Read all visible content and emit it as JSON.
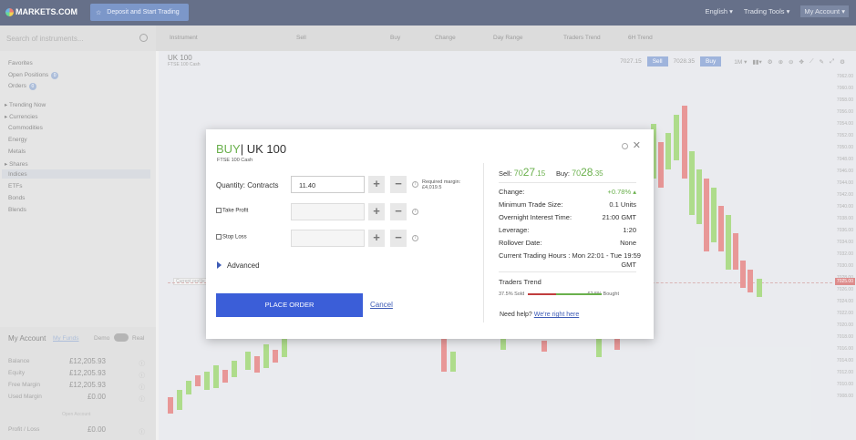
{
  "topbar": {
    "logo": "MARKETS.COM",
    "deposit_label": "Deposit and Start Trading",
    "language": "English ▾",
    "trading_tools": "Trading Tools ▾",
    "my_account": "My Account ▾"
  },
  "search": {
    "placeholder": "Search of instruments..."
  },
  "columns": [
    "Instrument",
    "Sell",
    "Buy",
    "Change",
    "Day Range",
    "Traders Trend",
    "6H Trend"
  ],
  "sidebar": {
    "favorites": "Favorites",
    "open_positions": "Open Positions",
    "open_positions_count": "0",
    "orders": "Orders",
    "orders_count": "0",
    "items": [
      "Trending Now",
      "Currencies",
      "Commodities",
      "Energy",
      "Metals",
      "Shares",
      "Indices",
      "ETFs",
      "Bonds",
      "Blends"
    ]
  },
  "account": {
    "title": "My Account",
    "my_funds": "My Funds",
    "demo": "Demo",
    "real": "Real",
    "rows": [
      {
        "label": "Balance",
        "value": "£12,205.93"
      },
      {
        "label": "Equity",
        "value": "£12,205.93"
      },
      {
        "label": "Free Margin",
        "value": "£12,205.93"
      },
      {
        "label": "Used Margin",
        "value": "£0.00"
      }
    ],
    "open_account": "Open Account",
    "pl_label": "Profit / Loss",
    "pl_value": "£0.00"
  },
  "chart": {
    "title": "UK 100",
    "subtitle": "FTSE 100 Cash",
    "sell_price": "7027.15",
    "sell_label": "Sell",
    "buy_price": "7028.35",
    "buy_label": "Buy",
    "timeframe": "1M ▾",
    "current_tag": "7025.00",
    "y_ticks": [
      "7062.00",
      "7060.00",
      "7058.00",
      "7056.00",
      "7054.00",
      "7052.00",
      "7050.00",
      "7048.00",
      "7046.00",
      "7044.00",
      "7042.00",
      "7040.00",
      "7038.00",
      "7036.00",
      "7034.00",
      "7032.00",
      "7030.00",
      "7028.00",
      "7026.00",
      "7024.00",
      "7022.00",
      "7020.00",
      "7018.00",
      "7016.00",
      "7014.00",
      "7012.00",
      "7010.00",
      "7008.00"
    ],
    "cursor_label": "Current profile"
  },
  "modal": {
    "action": "BUY",
    "instrument": "| UK 100",
    "subtitle": "FTSE 100 Cash",
    "quantity_label": "Quantity: Contracts",
    "quantity_value": "11.40",
    "required_margin_label": "Required margin:",
    "required_margin_value": "£4,019.5",
    "take_profit": "Take Profit",
    "stop_loss": "Stop Loss",
    "advanced": "Advanced",
    "place_order": "PLACE ORDER",
    "cancel": "Cancel",
    "sell_label": "Sell:",
    "sell_big": "70",
    "sell_mid": "27",
    "sell_small": ".15",
    "buy_label": "Buy:",
    "buy_big": "70",
    "buy_mid": "28",
    "buy_small": ".35",
    "details": [
      {
        "label": "Change:",
        "value": "+0.78% ▴"
      },
      {
        "label": "Minimum Trade Size:",
        "value": "0.1 Units"
      },
      {
        "label": "Overnight Interest Time:",
        "value": "21:00 GMT"
      },
      {
        "label": "Leverage:",
        "value": "1:20"
      },
      {
        "label": "Rollover Date:",
        "value": "None"
      }
    ],
    "hours_label": "Current Trading Hours : Mon 22:01 - Tue 19:59",
    "hours_tz": "GMT",
    "traders_trend": "Traders Trend",
    "sold": "37.5% Sold",
    "bought": "62.5% Bought",
    "help": "Need help?",
    "help_link": "We're right here",
    "accent_green": "#6ab04c",
    "accent_blue": "#3b5ed8"
  }
}
